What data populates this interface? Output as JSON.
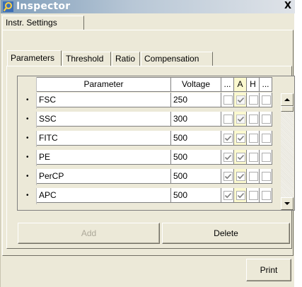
{
  "window": {
    "title": "Inspector",
    "close_glyph": "X"
  },
  "outer_tab": {
    "label": "Instr. Settings"
  },
  "inner_tabs": [
    {
      "label": "Parameters",
      "active": true
    },
    {
      "label": "Threshold",
      "active": false
    },
    {
      "label": "Ratio",
      "active": false
    },
    {
      "label": "Compensation",
      "active": false
    }
  ],
  "grid": {
    "columns": [
      {
        "label": "Parameter"
      },
      {
        "label": "Voltage"
      },
      {
        "label": "..."
      },
      {
        "label": "A"
      },
      {
        "label": "H"
      },
      {
        "label": "..."
      }
    ],
    "rows": [
      {
        "marker": "•",
        "name": "FSC",
        "voltage": "250",
        "c1": false,
        "a": true,
        "a_disabled": true,
        "h": false,
        "c4": false
      },
      {
        "marker": "•",
        "name": "SSC",
        "voltage": "300",
        "c1": false,
        "a": true,
        "a_disabled": true,
        "h": false,
        "c4": false
      },
      {
        "marker": "•",
        "name": "FITC",
        "voltage": "500",
        "c1": true,
        "a": true,
        "a_disabled": false,
        "h": false,
        "c4": false
      },
      {
        "marker": "•",
        "name": "PE",
        "voltage": "500",
        "c1": true,
        "a": true,
        "a_disabled": false,
        "h": false,
        "c4": false
      },
      {
        "marker": "•",
        "name": "PerCP",
        "voltage": "500",
        "c1": true,
        "a": true,
        "a_disabled": false,
        "h": false,
        "c4": false
      },
      {
        "marker": "•",
        "name": "APC",
        "voltage": "500",
        "c1": true,
        "a": true,
        "a_disabled": false,
        "h": false,
        "c4": false
      }
    ]
  },
  "buttons": {
    "add": "Add",
    "delete": "Delete",
    "print": "Print"
  },
  "colors": {
    "accent_column": "#fbf9cf",
    "title_gradient_start": "#7f9db9",
    "face": "#ece9d8"
  }
}
